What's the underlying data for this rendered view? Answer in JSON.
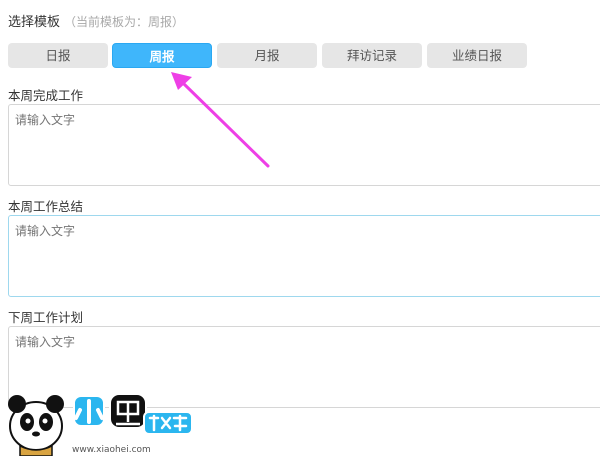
{
  "header": {
    "title": "选择模板",
    "current": "（当前模板为：周报）"
  },
  "tabs": [
    {
      "label": "日报",
      "active": false
    },
    {
      "label": "周报",
      "active": true
    },
    {
      "label": "月报",
      "active": false
    },
    {
      "label": "拜访记录",
      "active": false
    },
    {
      "label": "业绩日报",
      "active": false
    }
  ],
  "sections": [
    {
      "label": "本周完成工作",
      "placeholder": "请输入文字"
    },
    {
      "label": "本周工作总结",
      "placeholder": "请输入文字"
    },
    {
      "label": "下周工作计划",
      "placeholder": "请输入文字"
    }
  ],
  "watermark": {
    "text": "小黑游戏",
    "url": "www.xiaohei.com"
  },
  "colors": {
    "active_tab": "#3fb6fb",
    "arrow": "#ee3fe6"
  }
}
